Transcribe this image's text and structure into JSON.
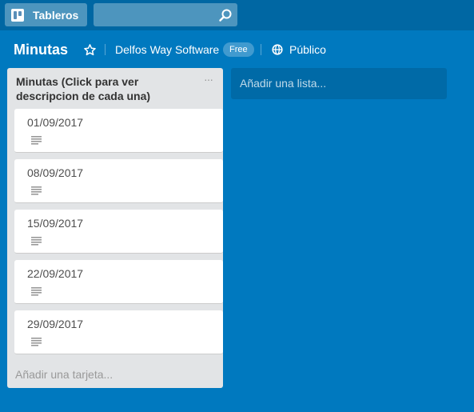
{
  "topbar": {
    "boards_label": "Tableros",
    "search": {
      "value": "",
      "placeholder": ""
    }
  },
  "board": {
    "title": "Minutas",
    "team_name": "Delfos Way Software",
    "team_badge": "Free",
    "visibility": "Público"
  },
  "list": {
    "title": "Minutas (Click para ver descripcion de cada una)",
    "menu_glyph": "···",
    "cards": [
      {
        "title": "01/09/2017"
      },
      {
        "title": "08/09/2017"
      },
      {
        "title": "15/09/2017"
      },
      {
        "title": "22/09/2017"
      },
      {
        "title": "29/09/2017"
      }
    ],
    "add_card_label": "Añadir una tarjeta..."
  },
  "add_list_label": "Añadir una lista...",
  "icons": {
    "boards": "boards-icon",
    "search": "search-icon",
    "star": "star-icon",
    "visibility": "globe-icon",
    "description": "description-icon",
    "menu": "ellipsis-icon"
  },
  "colors": {
    "background": "#0079bf",
    "topbar": "#0067a3",
    "list": "#e2e4e6",
    "card": "#ffffff"
  }
}
